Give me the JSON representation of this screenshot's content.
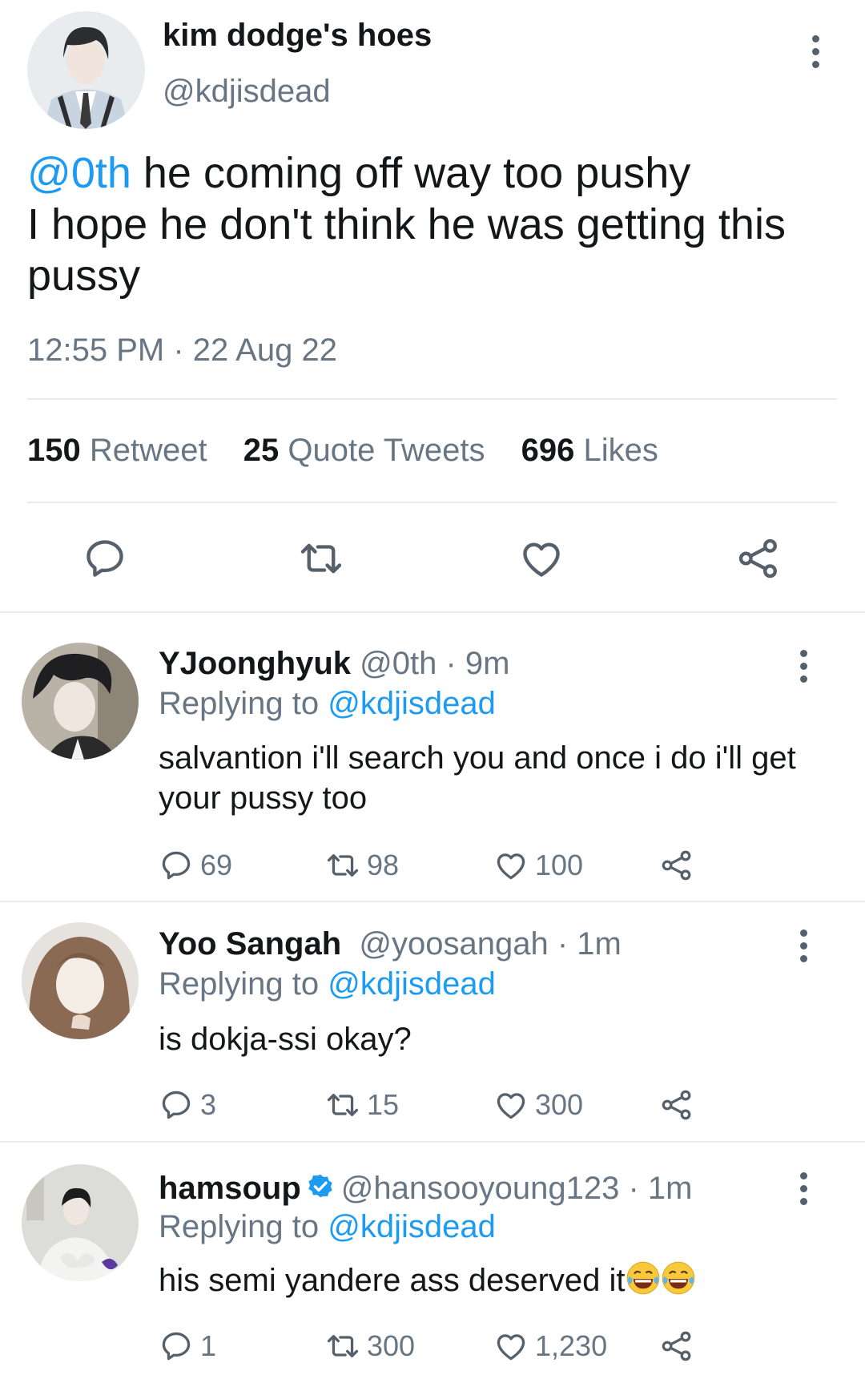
{
  "tweet": {
    "author_name": "kim dodge's hoes",
    "author_handle": "@kdjisdead",
    "mention": "@0th",
    "text_line1": " he coming off way too pushy",
    "text_rest": "I hope he don't think he was getting this pussy",
    "timestamp": "12:55 PM · 22 Aug 22",
    "stats": {
      "retweets_count": "150",
      "retweets_label": "Retweet",
      "quotes_count": "25",
      "quotes_label": "Quote Tweets",
      "likes_count": "696",
      "likes_label": "Likes"
    }
  },
  "replies": [
    {
      "name": "YJoonghyuk",
      "handle": "@0th",
      "time": "9m",
      "replying_prefix": "Replying to ",
      "replying_to": "@kdjisdead",
      "text": "salvantion i'll search you and once i do i'll get your pussy too",
      "replies": "69",
      "retweets": "98",
      "likes": "100"
    },
    {
      "name": "Yoo Sangah",
      "handle": "@yoosangah",
      "time": "1m",
      "replying_prefix": "Replying to ",
      "replying_to": "@kdjisdead",
      "text": "is dokja-ssi okay?",
      "replies": "3",
      "retweets": "15",
      "likes": "300"
    },
    {
      "name": "hamsoup",
      "handle": "@hansooyoung123",
      "time": "1m",
      "replying_prefix": "Replying to ",
      "replying_to": "@kdjisdead",
      "text": "his semi yandere ass deserved it",
      "replies": "1",
      "retweets": "300",
      "likes": "1,230",
      "verified": true
    }
  ],
  "colors": {
    "link": "#1d9bf0",
    "muted": "#687684",
    "text": "#141619",
    "divider": "#e6ecf0"
  },
  "icons": [
    "kebab-menu-icon",
    "reply-icon",
    "retweet-icon",
    "like-icon",
    "share-icon",
    "verified-badge-icon",
    "laughing-emoji-icon"
  ]
}
